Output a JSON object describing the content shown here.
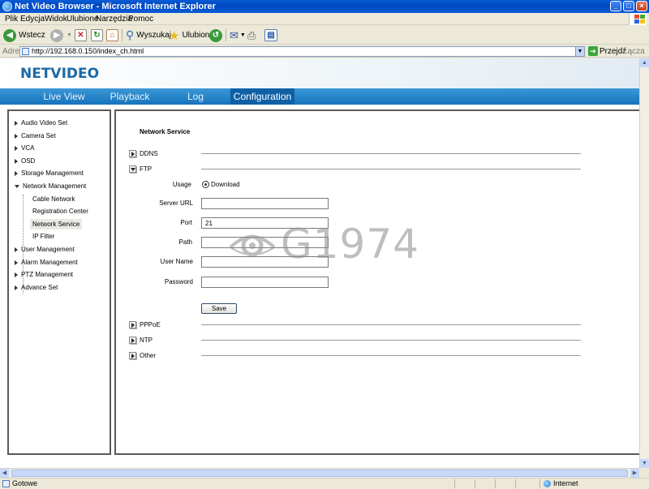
{
  "window": {
    "title": "Net Video Browser - Microsoft Internet Explorer",
    "controls": [
      "_",
      "□",
      "×"
    ]
  },
  "menu": [
    "Plik",
    "Edycja",
    "Widok",
    "Ulubione",
    "Narzędzia",
    "Pomoc"
  ],
  "toolbar": {
    "back_label": "Wstecz",
    "search_label": "Wyszukaj",
    "favorites_label": "Ulubione"
  },
  "address": {
    "label": "Adres",
    "url": "http://192.168.0.150/index_ch.html",
    "go_label": "Przejdź",
    "links_label": "Łącza"
  },
  "app": {
    "logo": "NETVIDEO",
    "nav": [
      "Live View",
      "Playback",
      "Log",
      "Configuration"
    ],
    "active_tab": "Configuration"
  },
  "tree": {
    "items": [
      "Audio Video Set",
      "Camera Set",
      "VCA",
      "OSD",
      "Storage Management",
      "Network Management",
      "User Management",
      "Alarm Management",
      "PTZ Management",
      "Advance Set"
    ],
    "network_children": [
      "Cable Network",
      "Registration Center",
      "Network Service",
      "IP Filter"
    ],
    "selected": "Network Service"
  },
  "content": {
    "section_title": "Network Service",
    "accordions": {
      "ddns": "DDNS",
      "ftp": "FTP",
      "pppoe": "PPPoE",
      "ntp": "NTP",
      "other": "Other"
    },
    "ftp": {
      "usage_label": "Usage",
      "usage_value": "Download",
      "server_url_label": "Server URL",
      "server_url_value": "",
      "port_label": "Port",
      "port_value": "21",
      "path_label": "Path",
      "path_value": "",
      "user_name_label": "User Name",
      "user_name_value": "",
      "password_label": "Password",
      "password_value": "",
      "save_label": "Save"
    }
  },
  "watermark": "G1974",
  "status": {
    "text": "Gotowe",
    "zone": "Internet"
  },
  "colors": {
    "nav_bar": "#1774bd",
    "nav_active": "#1060a6",
    "logo": "#1b6aa8",
    "title_bar": "#0a5bd8"
  }
}
